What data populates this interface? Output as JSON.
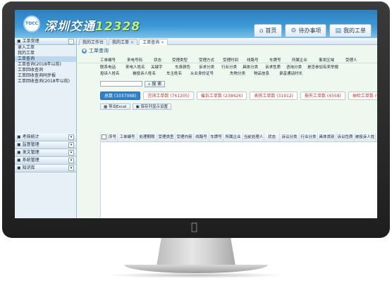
{
  "header": {
    "logo_small": "TOCC",
    "title": "深圳交通",
    "number": "12328",
    "buttons": [
      {
        "label": "首页",
        "icon": "home-icon"
      },
      {
        "label": "待办事项",
        "icon": "gear-icon"
      },
      {
        "label": "我的工单",
        "icon": "document-icon"
      }
    ]
  },
  "sidebar": {
    "top_section": {
      "title": "工单受理",
      "toggle": "-"
    },
    "items": [
      "录入工单",
      "我的工单",
      "工单查询",
      "工单查询(2018年以前)",
      "工单回收查询",
      "工单回收查询同步报",
      "工单回收查询(2018年以前)"
    ],
    "active_index": 2,
    "bottom_sections": [
      {
        "title": "考核统计",
        "toggle": "▾"
      },
      {
        "title": "监督管理",
        "toggle": "▾"
      },
      {
        "title": "发文管理",
        "toggle": "▾"
      },
      {
        "title": "系统管理",
        "toggle": "▾"
      },
      {
        "title": "知识库",
        "toggle": "▾"
      }
    ]
  },
  "tabs": [
    {
      "label": "我的工作台"
    },
    {
      "label": "我的工单",
      "close": "×"
    },
    {
      "label": "工单查询",
      "close": "×"
    }
  ],
  "panel": {
    "title": "工单查询"
  },
  "filters": {
    "row1": [
      "工单编号",
      "来电号码",
      "状态",
      "受理类型",
      "受理方式",
      "受理时间",
      "线路号",
      "车牌号",
      "所属企业",
      "事发区域",
      "受理人"
    ],
    "row2": [
      "联系电话",
      "来电人姓名",
      "关键字",
      "车身颜色",
      "诉求分类",
      "行业分类",
      "具体分类",
      "诉求性质",
      "咨询分类",
      "是否参加有奖举报"
    ],
    "row3": [
      "投诉人姓名",
      "被投诉人姓名",
      "车主姓名",
      "从业身份证号",
      "失物分类",
      "物品信息",
      "录音通话时长"
    ]
  },
  "search": {
    "button_label": "搜 索",
    "placeholder": ""
  },
  "stats": [
    {
      "label": "总数 (1037068)",
      "primary": true
    },
    {
      "label": "咨询工单数 (761205)"
    },
    {
      "label": "催诉工单数 (238426)"
    },
    {
      "label": "表扬工单数 (31912)"
    },
    {
      "label": "报失工单数 (4558)"
    },
    {
      "label": "抽检工单数 (967)"
    }
  ],
  "toolbar": {
    "export": "导出Excel",
    "save_columns": "保存列显示设置"
  },
  "table": {
    "columns": [
      "序号",
      "工单编号",
      "处理期限",
      "受理类型",
      "受理内容",
      "线路号",
      "车牌号",
      "所属企业",
      "当前处理人",
      "状态",
      "诉讼分类",
      "行业分类",
      "具体类别",
      "诉讼性质",
      "被投诉人姓"
    ]
  },
  "colors": {
    "accent": "#2f80c9",
    "header": "#3f9ad6",
    "stat_text": "#c0392b"
  }
}
